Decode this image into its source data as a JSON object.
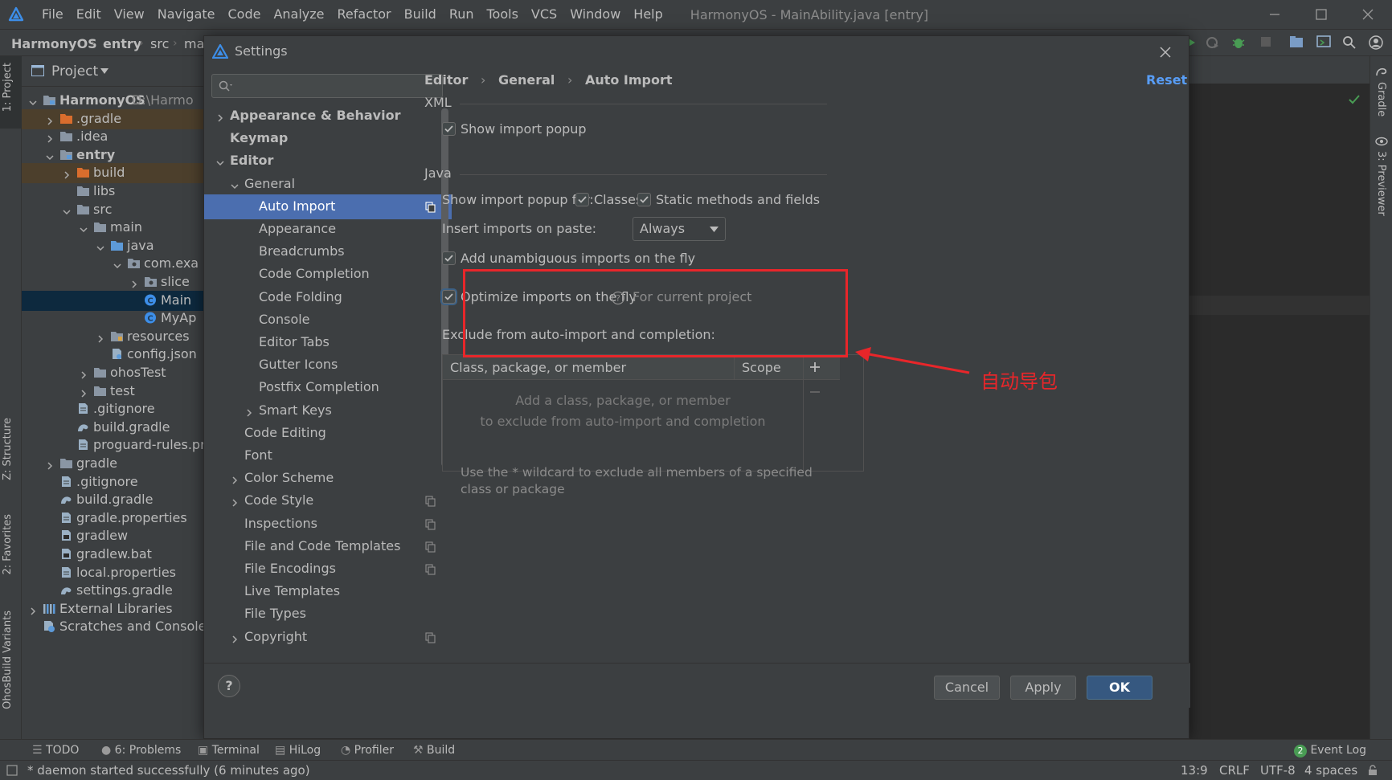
{
  "app": {
    "menu": [
      "File",
      "Edit",
      "View",
      "Navigate",
      "Code",
      "Analyze",
      "Refactor",
      "Build",
      "Run",
      "Tools",
      "VCS",
      "Window",
      "Help"
    ],
    "window_title": "HarmonyOS - MainAbility.java [entry]"
  },
  "navbar": {
    "crumbs": [
      "HarmonyOS",
      "entry",
      "src",
      "ma"
    ]
  },
  "project_panel": {
    "title": "Project",
    "rows": [
      {
        "label": "HarmonyOS",
        "extra": "D:\\Harmo",
        "depth": 0,
        "arrow": "down",
        "icon": "folder-module",
        "bold": true
      },
      {
        "label": ".gradle",
        "depth": 1,
        "arrow": "right",
        "icon": "folder-orange",
        "state": "excl"
      },
      {
        "label": ".idea",
        "depth": 1,
        "arrow": "right",
        "icon": "folder"
      },
      {
        "label": "entry",
        "depth": 1,
        "arrow": "down",
        "icon": "folder-module",
        "bold": true
      },
      {
        "label": "build",
        "depth": 2,
        "arrow": "right",
        "icon": "folder-orange",
        "state": "excl"
      },
      {
        "label": "libs",
        "depth": 2,
        "arrow": "",
        "icon": "folder"
      },
      {
        "label": "src",
        "depth": 2,
        "arrow": "down",
        "icon": "folder"
      },
      {
        "label": "main",
        "depth": 3,
        "arrow": "down",
        "icon": "folder"
      },
      {
        "label": "java",
        "depth": 4,
        "arrow": "down",
        "icon": "folder-blue"
      },
      {
        "label": "com.exa",
        "depth": 5,
        "arrow": "down",
        "icon": "package"
      },
      {
        "label": "slice",
        "depth": 6,
        "arrow": "right",
        "icon": "package"
      },
      {
        "label": "Main",
        "depth": 6,
        "arrow": "",
        "icon": "class",
        "state": "sel"
      },
      {
        "label": "MyAp",
        "depth": 6,
        "arrow": "",
        "icon": "class"
      },
      {
        "label": "resources",
        "depth": 4,
        "arrow": "right",
        "icon": "folder-res"
      },
      {
        "label": "config.json",
        "depth": 4,
        "arrow": "",
        "icon": "file-json"
      },
      {
        "label": "ohosTest",
        "depth": 3,
        "arrow": "right",
        "icon": "folder"
      },
      {
        "label": "test",
        "depth": 3,
        "arrow": "right",
        "icon": "folder"
      },
      {
        "label": ".gitignore",
        "depth": 2,
        "arrow": "",
        "icon": "file"
      },
      {
        "label": "build.gradle",
        "depth": 2,
        "arrow": "",
        "icon": "gradle"
      },
      {
        "label": "proguard-rules.pr",
        "depth": 2,
        "arrow": "",
        "icon": "file"
      },
      {
        "label": "gradle",
        "depth": 1,
        "arrow": "right",
        "icon": "folder"
      },
      {
        "label": ".gitignore",
        "depth": 1,
        "arrow": "",
        "icon": "file"
      },
      {
        "label": "build.gradle",
        "depth": 1,
        "arrow": "",
        "icon": "gradle"
      },
      {
        "label": "gradle.properties",
        "depth": 1,
        "arrow": "",
        "icon": "file"
      },
      {
        "label": "gradlew",
        "depth": 1,
        "arrow": "",
        "icon": "file-exec"
      },
      {
        "label": "gradlew.bat",
        "depth": 1,
        "arrow": "",
        "icon": "file-exec"
      },
      {
        "label": "local.properties",
        "depth": 1,
        "arrow": "",
        "icon": "file"
      },
      {
        "label": "settings.gradle",
        "depth": 1,
        "arrow": "",
        "icon": "gradle"
      },
      {
        "label": "External Libraries",
        "depth": 0,
        "arrow": "right",
        "icon": "libraries"
      },
      {
        "label": "Scratches and Consoles",
        "depth": 0,
        "arrow": "",
        "icon": "scratches"
      }
    ]
  },
  "left_strip_tabs": [
    "1: Project",
    "Z: Structure",
    "2: Favorites",
    "OhosBuild Variants"
  ],
  "right_strip_tabs": [
    "Gradle",
    "3: Previewer"
  ],
  "dialog": {
    "title": "Settings",
    "search_placeholder": "",
    "tree": [
      {
        "label": "Appearance & Behavior",
        "depth": 0,
        "arrow": "right",
        "bold": true
      },
      {
        "label": "Keymap",
        "depth": 0,
        "arrow": "",
        "bold": true
      },
      {
        "label": "Editor",
        "depth": 0,
        "arrow": "down",
        "bold": true
      },
      {
        "label": "General",
        "depth": 1,
        "arrow": "down"
      },
      {
        "label": "Auto Import",
        "depth": 2,
        "arrow": "",
        "selected": true,
        "copy": true
      },
      {
        "label": "Appearance",
        "depth": 2,
        "arrow": ""
      },
      {
        "label": "Breadcrumbs",
        "depth": 2,
        "arrow": ""
      },
      {
        "label": "Code Completion",
        "depth": 2,
        "arrow": ""
      },
      {
        "label": "Code Folding",
        "depth": 2,
        "arrow": ""
      },
      {
        "label": "Console",
        "depth": 2,
        "arrow": ""
      },
      {
        "label": "Editor Tabs",
        "depth": 2,
        "arrow": ""
      },
      {
        "label": "Gutter Icons",
        "depth": 2,
        "arrow": ""
      },
      {
        "label": "Postfix Completion",
        "depth": 2,
        "arrow": ""
      },
      {
        "label": "Smart Keys",
        "depth": 2,
        "arrow": "right"
      },
      {
        "label": "Code Editing",
        "depth": 1,
        "arrow": ""
      },
      {
        "label": "Font",
        "depth": 1,
        "arrow": ""
      },
      {
        "label": "Color Scheme",
        "depth": 1,
        "arrow": "right"
      },
      {
        "label": "Code Style",
        "depth": 1,
        "arrow": "right",
        "copy": true
      },
      {
        "label": "Inspections",
        "depth": 1,
        "arrow": "",
        "copy": true
      },
      {
        "label": "File and Code Templates",
        "depth": 1,
        "arrow": "",
        "copy": true
      },
      {
        "label": "File Encodings",
        "depth": 1,
        "arrow": "",
        "copy": true
      },
      {
        "label": "Live Templates",
        "depth": 1,
        "arrow": ""
      },
      {
        "label": "File Types",
        "depth": 1,
        "arrow": ""
      },
      {
        "label": "Copyright",
        "depth": 1,
        "arrow": "right",
        "copy": true,
        "partial": true
      }
    ],
    "breadcrumb": [
      "Editor",
      "General",
      "Auto Import"
    ],
    "reset": "Reset",
    "xml_section": "XML",
    "xml_show_popup": "Show import popup",
    "java_section": "Java",
    "show_popup_for": "Show import popup for:",
    "classes": "Classes",
    "static_methods": "Static methods and fields",
    "insert_on_paste": "Insert imports on paste:",
    "insert_on_paste_value": "Always",
    "add_unambiguous": "Add unambiguous imports on the fly",
    "optimize_imports": "Optimize imports on the fly",
    "for_current_project": "For current project",
    "exclude_label": "Exclude from auto-import and completion:",
    "table_headers": [
      "Class, package, or member",
      "Scope"
    ],
    "table_empty": [
      "Add a class, package, or member",
      "to exclude from auto-import and completion"
    ],
    "hint": "Use the * wildcard to exclude all members of a specified class or package",
    "buttons": {
      "help": "?",
      "cancel": "Cancel",
      "apply": "Apply",
      "ok": "OK"
    }
  },
  "annotation": {
    "text": "自动导包",
    "color": "#e8262a"
  },
  "toolwindows": [
    "TODO",
    "6: Problems",
    "Terminal",
    "HiLog",
    "Profiler",
    "Build"
  ],
  "problems_count_underline": "6",
  "event_log": {
    "badge": "2",
    "label": "Event Log"
  },
  "status": {
    "message": "* daemon started successfully (6 minutes ago)",
    "position": "13:9",
    "line_sep": "CRLF",
    "encoding": "UTF-8",
    "indent": "4 spaces"
  },
  "colors": {
    "accent": "#4b6eaf",
    "link": "#589df6",
    "primary_button": "#365880"
  }
}
